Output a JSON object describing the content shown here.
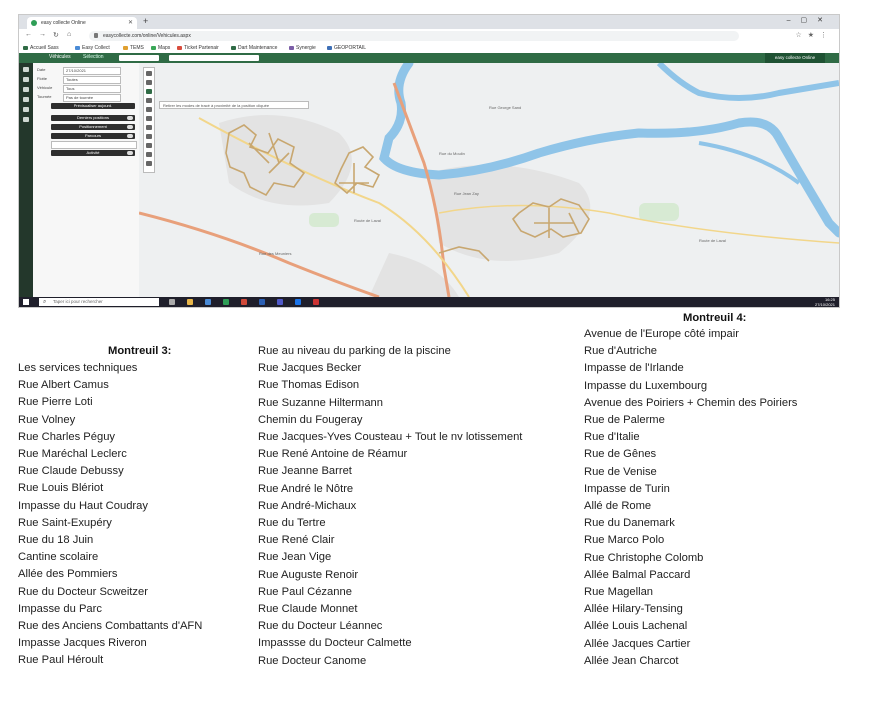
{
  "browser": {
    "tab_title": "easy collecte Online",
    "url": "easycollecte.com/online/Vehicules.aspx",
    "bookmarks": [
      "Accueil Sass",
      "Easy Collect",
      "TEMS",
      "Maps",
      "Ticket Partenair",
      "Dart Maintenance",
      "Synergie",
      "GEOPORTAIL"
    ]
  },
  "app": {
    "header_label": "Véhicules",
    "brand_line1": "easy collecte Online",
    "brand_line2": "Suivi Online",
    "filter_label": "Sélection",
    "panel_rows": [
      {
        "label": "Date",
        "value": "27/10/2021"
      },
      {
        "label": "Flotte",
        "value": "Toutes"
      },
      {
        "label": "Véhicule",
        "value": "Tous"
      },
      {
        "label": "Tournée",
        "value": "Pas de tournée"
      }
    ],
    "panel_bars": [
      "Prévisualiser aujourd.",
      "Derniers positions",
      "Positionnement",
      "Parcours",
      "Activité"
    ],
    "map_tip": "Retirer les modes de tracé à proximité de la position cliquée"
  },
  "map": {
    "labels": [
      "Rue George Sand",
      "Rue du Moulin",
      "Rue Jean Zay",
      "Rue des Meuniers",
      "Route de Laval",
      "Route de Laval"
    ],
    "colors": {
      "river": "#8fc4e8",
      "road_major": "#e8a07b",
      "road_secondary": "#f2d68a",
      "route_trace": "#c8a770",
      "land": "#eef0f1",
      "green": "#d7ead3",
      "urban": "#e3e3e3"
    }
  },
  "taskbar": {
    "search_placeholder": "Taper ici pour rechercher",
    "time": "16:25",
    "date": "27/10/2021"
  },
  "lists": {
    "montreuil3_title": "Montreuil 3:",
    "col1": [
      "Les services techniques",
      "Rue Albert Camus",
      "Rue Pierre Loti",
      "Rue Volney",
      "Rue Charles Péguy",
      "Rue Maréchal Leclerc",
      "Rue Claude Debussy",
      "Rue Louis Blériot",
      "Impasse du Haut Coudray",
      "Rue Saint-Exupéry",
      "Rue du 18 Juin",
      "Cantine scolaire",
      "Allée des Pommiers",
      "Rue du Docteur Scweitzer",
      "Impasse du Parc",
      "Rue des Anciens Combattants d'AFN",
      "Impasse Jacques Riveron",
      "Rue Paul Héroult"
    ],
    "col2": [
      "Rue au niveau du parking de la piscine",
      "Rue Jacques Becker",
      "Rue Thomas Edison",
      "Rue Suzanne Hiltermann",
      "Chemin du Fougeray",
      "Rue Jacques-Yves Cousteau + Tout le nv lotissement",
      "Rue René Antoine de Réamur",
      "Rue Jeanne Barret",
      "Rue André le Nôtre",
      "Rue André-Michaux",
      "Rue du Tertre",
      "Rue René Clair",
      "Rue Jean Vige",
      "Rue Auguste Renoir",
      "Rue Paul Cézanne",
      "Rue Claude Monnet",
      "Rue du Docteur Léannec",
      "Impassse du Docteur Calmette",
      "Rue Docteur Canome"
    ],
    "montreuil4_title": "Montreuil 4:",
    "col3": [
      "Avenue de l'Europe côté impair",
      "Rue d'Autriche",
      "Impasse de l'Irlande",
      "Impasse du Luxembourg",
      "Avenue des Poiriers + Chemin des Poiriers",
      "Rue de Palerme",
      "Rue d'Italie",
      "Rue de Gênes",
      "Rue de Venise",
      "Impasse de Turin",
      "Allé de Rome",
      "Rue du Danemark",
      "Rue Marco Polo",
      "Rue Christophe Colomb",
      "Allée Balmal Paccard",
      "Rue Magellan",
      "Allée Hilary-Tensing",
      "Allée Louis Lachenal",
      "Allée Jacques Cartier",
      "Allée Jean Charcot"
    ]
  }
}
